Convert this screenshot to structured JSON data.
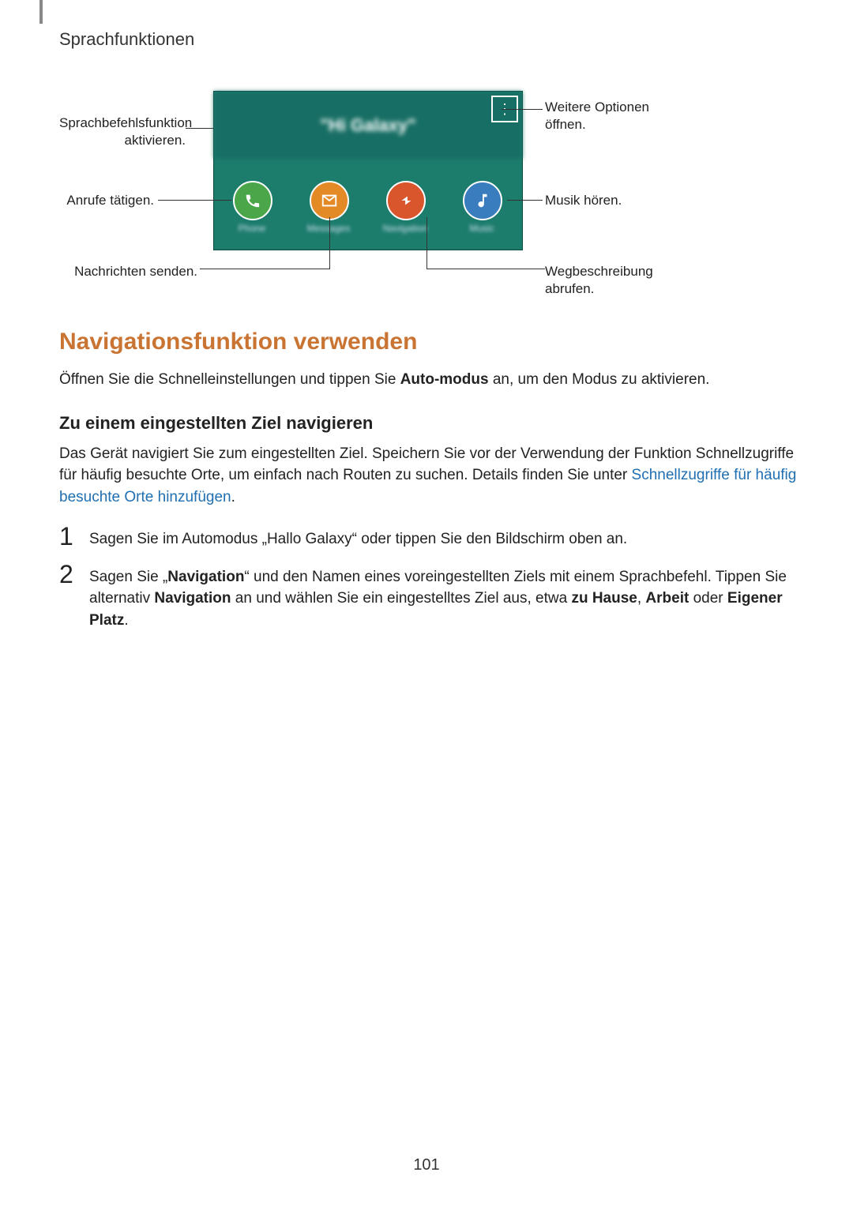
{
  "header": {
    "title": "Sprachfunktionen"
  },
  "page_number": "101",
  "figure": {
    "banner_text": "\"Hi Galaxy\"",
    "icons": [
      {
        "name": "phone",
        "label": "Phone"
      },
      {
        "name": "messages",
        "label": "Messages"
      },
      {
        "name": "navigation",
        "label": "Navigation"
      },
      {
        "name": "music",
        "label": "Music"
      }
    ],
    "callouts": {
      "voice": "Sprachbefehlsfunktion aktivieren.",
      "call": "Anrufe tätigen.",
      "messages": "Nachrichten senden.",
      "options": "Weitere Optionen öffnen.",
      "music": "Musik hören.",
      "navigation": "Wegbeschreibung abrufen."
    }
  },
  "section": {
    "heading": "Navigationsfunktion verwenden",
    "intro_pre": "Öffnen Sie die Schnelleinstellungen und tippen Sie ",
    "intro_bold": "Auto-modus",
    "intro_post": " an, um den Modus zu aktivieren.",
    "subheading": "Zu einem eingestellten Ziel navigieren",
    "body1": "Das Gerät navigiert Sie zum eingestellten Ziel. Speichern Sie vor der Verwendung der Funktion Schnellzugriffe für häufig besuchte Orte, um einfach nach Routen zu suchen. Details finden Sie unter ",
    "body1_link": "Schnellzugriffe für häufig besuchte Orte hinzufügen",
    "body1_post": ".",
    "steps": [
      {
        "num": "1",
        "text": "Sagen Sie im Automodus „Hallo Galaxy“ oder tippen Sie den Bildschirm oben an."
      },
      {
        "num": "2",
        "pre": "Sagen Sie „",
        "b1": "Navigation",
        "mid1": "“ und den Namen eines voreingestellten Ziels mit einem Sprachbefehl. Tippen Sie alternativ ",
        "b2": "Navigation",
        "mid2": " an und wählen Sie ein eingestelltes Ziel aus, etwa ",
        "b3": "zu Hause",
        "sep1": ", ",
        "b4": "Arbeit",
        "mid3": " oder ",
        "b5": "Eigener Platz",
        "post": "."
      }
    ]
  }
}
